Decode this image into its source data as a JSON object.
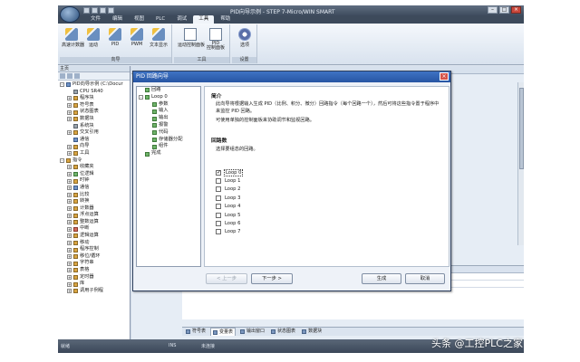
{
  "window": {
    "title": "PID向导示例 - STEP 7-Micro/WIN SMART",
    "controls": [
      "–",
      "□",
      "×"
    ]
  },
  "ribbon": {
    "tabs": [
      "文件",
      "编辑",
      "视图",
      "PLC",
      "调试",
      "工具",
      "帮助"
    ],
    "active_tab": "工具",
    "buttons": [
      {
        "label": "高速计数器",
        "icon": "wizard-icon"
      },
      {
        "label": "运动",
        "icon": "wizard-icon"
      },
      {
        "label": "PID",
        "icon": "wizard-icon"
      },
      {
        "label": "PWM",
        "icon": "wizard-icon"
      },
      {
        "label": "文本显示",
        "icon": "wizard-icon"
      },
      {
        "label": "运动控制面板",
        "icon": "panel-icon"
      },
      {
        "label": "PID\n控制面板",
        "icon": "panel-icon"
      },
      {
        "label": "选项",
        "icon": "gear-icon"
      }
    ],
    "group_labels": [
      "向导",
      "工具",
      "设置"
    ]
  },
  "left_pane": {
    "header": "主页",
    "tree": [
      {
        "label": "PID向导示例 (C:\\Docur",
        "level": 0,
        "exp": "-",
        "icon": "blue"
      },
      {
        "label": "CPU SR40",
        "level": 1,
        "exp": "",
        "icon": "gray"
      },
      {
        "label": "程序块",
        "level": 1,
        "exp": "+",
        "icon": "yellow"
      },
      {
        "label": "符号表",
        "level": 1,
        "exp": "+",
        "icon": "yellow"
      },
      {
        "label": "状态图表",
        "level": 1,
        "exp": "+",
        "icon": "yellow"
      },
      {
        "label": "数据块",
        "level": 1,
        "exp": "+",
        "icon": "yellow"
      },
      {
        "label": "系统块",
        "level": 1,
        "exp": "",
        "icon": "gray"
      },
      {
        "label": "交叉引用",
        "level": 1,
        "exp": "+",
        "icon": "yellow"
      },
      {
        "label": "通信",
        "level": 1,
        "exp": "",
        "icon": "blue"
      },
      {
        "label": "向导",
        "level": 1,
        "exp": "+",
        "icon": "yellow"
      },
      {
        "label": "工具",
        "level": 1,
        "exp": "+",
        "icon": "yellow"
      },
      {
        "label": "指令",
        "level": 0,
        "exp": "-",
        "icon": "yellow"
      },
      {
        "label": "收藏夹",
        "level": 1,
        "exp": "+",
        "icon": "yellow"
      },
      {
        "label": "位逻辑",
        "level": 1,
        "exp": "+",
        "icon": "green"
      },
      {
        "label": "时钟",
        "level": 1,
        "exp": "+",
        "icon": "yellow"
      },
      {
        "label": "通信",
        "level": 1,
        "exp": "+",
        "icon": "blue"
      },
      {
        "label": "比较",
        "level": 1,
        "exp": "+",
        "icon": "yellow"
      },
      {
        "label": "转换",
        "level": 1,
        "exp": "+",
        "icon": "yellow"
      },
      {
        "label": "计数器",
        "level": 1,
        "exp": "+",
        "icon": "yellow"
      },
      {
        "label": "浮点运算",
        "level": 1,
        "exp": "+",
        "icon": "yellow"
      },
      {
        "label": "整数运算",
        "level": 1,
        "exp": "+",
        "icon": "yellow"
      },
      {
        "label": "中断",
        "level": 1,
        "exp": "+",
        "icon": "red"
      },
      {
        "label": "逻辑运算",
        "level": 1,
        "exp": "+",
        "icon": "yellow"
      },
      {
        "label": "移动",
        "level": 1,
        "exp": "+",
        "icon": "yellow"
      },
      {
        "label": "程序控制",
        "level": 1,
        "exp": "+",
        "icon": "yellow"
      },
      {
        "label": "移位/循环",
        "level": 1,
        "exp": "+",
        "icon": "yellow"
      },
      {
        "label": "字符串",
        "level": 1,
        "exp": "+",
        "icon": "yellow"
      },
      {
        "label": "表格",
        "level": 1,
        "exp": "+",
        "icon": "yellow"
      },
      {
        "label": "定时器",
        "level": 1,
        "exp": "+",
        "icon": "yellow"
      },
      {
        "label": "库",
        "level": 1,
        "exp": "+",
        "icon": "yellow"
      },
      {
        "label": "调用子例程",
        "level": 1,
        "exp": "+",
        "icon": "yellow"
      }
    ]
  },
  "symbol_table": {
    "rows": [
      {
        "idx": "3",
        "name": "",
        "type": "TEMP"
      },
      {
        "idx": "4",
        "name": "",
        "type": "TEMP"
      }
    ]
  },
  "bottom_tabs": [
    "符号表",
    "变量表",
    "输出窗口",
    "状态图表",
    "数据块"
  ],
  "active_bottom_tab": "变量表",
  "status": {
    "left": "就绪",
    "ins": "INS",
    "connection": "未连接"
  },
  "dialog": {
    "title": "PID 回路向导",
    "close": "×",
    "tree": [
      {
        "label": "回路",
        "level": 0,
        "exp": "",
        "icon": "green"
      },
      {
        "label": "Loop 0",
        "level": 0,
        "exp": "-",
        "icon": "green"
      },
      {
        "label": "参数",
        "level": 1,
        "exp": "",
        "icon": "green"
      },
      {
        "label": "输入",
        "level": 1,
        "exp": "",
        "icon": "green"
      },
      {
        "label": "输出",
        "level": 1,
        "exp": "",
        "icon": "green"
      },
      {
        "label": "报警",
        "level": 1,
        "exp": "",
        "icon": "green"
      },
      {
        "label": "代码",
        "level": 1,
        "exp": "",
        "icon": "green"
      },
      {
        "label": "存储器分配",
        "level": 1,
        "exp": "",
        "icon": "green"
      },
      {
        "label": "组件",
        "level": 1,
        "exp": "",
        "icon": "green"
      },
      {
        "label": "完成",
        "level": 0,
        "exp": "",
        "icon": "green"
      }
    ],
    "intro_heading": "简介",
    "intro_text_1": "此向导将根据输入生成 PID（比例、积分、微分）回路指令（每个回路一个），然后可将这些指令置于程序中来监控 PID 回路。",
    "intro_text_2": "可使用单独的控制面板来协助调节和监视回路。",
    "loops_heading": "回路数",
    "loops_prompt": "选择要组态的回路。",
    "loops": [
      {
        "label": "Loop 0",
        "checked": true
      },
      {
        "label": "Loop 1",
        "checked": false
      },
      {
        "label": "Loop 2",
        "checked": false
      },
      {
        "label": "Loop 3",
        "checked": false
      },
      {
        "label": "Loop 4",
        "checked": false
      },
      {
        "label": "Loop 5",
        "checked": false
      },
      {
        "label": "Loop 6",
        "checked": false
      },
      {
        "label": "Loop 7",
        "checked": false
      }
    ],
    "buttons": {
      "prev": "< 上一步",
      "next": "下一步 >",
      "finish": "生成",
      "cancel": "取消"
    }
  },
  "watermark": "头条 @工控PLC之家"
}
